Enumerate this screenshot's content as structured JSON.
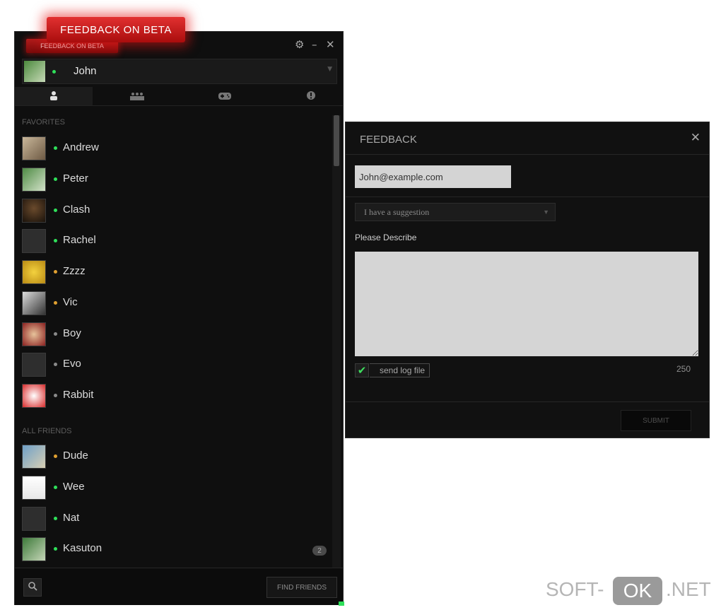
{
  "beta_callout": "FEEDBACK ON BETA",
  "main_window": {
    "beta_tag": "FEEDBACK ON BETA",
    "controls": {
      "settings": "⚙",
      "minimize": "–",
      "close": "✕"
    },
    "user": {
      "name": "John",
      "status_color": "#2fe05a"
    },
    "tabs": [
      {
        "icon": "person-icon",
        "glyph": "👤"
      },
      {
        "icon": "group-icon",
        "glyph": "▦"
      },
      {
        "icon": "gamepad-icon",
        "glyph": "🎮"
      },
      {
        "icon": "alert-icon",
        "glyph": "!"
      }
    ],
    "sections": {
      "favorites": "FAVORITES",
      "all_friends": "ALL FRIENDS"
    },
    "favorites": [
      {
        "name": "Andrew",
        "status": "online"
      },
      {
        "name": "Peter",
        "status": "online"
      },
      {
        "name": "Clash",
        "status": "online"
      },
      {
        "name": "Rachel",
        "status": "online"
      },
      {
        "name": "Zzzz",
        "status": "away"
      },
      {
        "name": "Vic",
        "status": "away"
      },
      {
        "name": "Boy",
        "status": "offline"
      },
      {
        "name": "Evo",
        "status": "offline"
      },
      {
        "name": "Rabbit",
        "status": "offline"
      }
    ],
    "all_friends": [
      {
        "name": "Dude",
        "status": "away"
      },
      {
        "name": "Wee",
        "status": "online"
      },
      {
        "name": "Nat",
        "status": "online"
      },
      {
        "name": "Kasuton",
        "status": "online"
      }
    ],
    "unread_badge": "2",
    "find_friends": "FIND FRIENDS",
    "status_colors": {
      "online": "#2fe05a",
      "away": "#e0a030",
      "offline": "#8a8a8a"
    }
  },
  "feedback": {
    "title": "FEEDBACK",
    "close": "✕",
    "email_value": "John@example.com",
    "category": "I have a suggestion",
    "describe_label": "Please Describe",
    "send_log_label": "send log file",
    "send_log_checked": true,
    "char_count": "250",
    "submit": "SUBMIT"
  },
  "watermark": {
    "left": "SOFT-",
    "ok": "OK",
    "right": ".NET"
  }
}
